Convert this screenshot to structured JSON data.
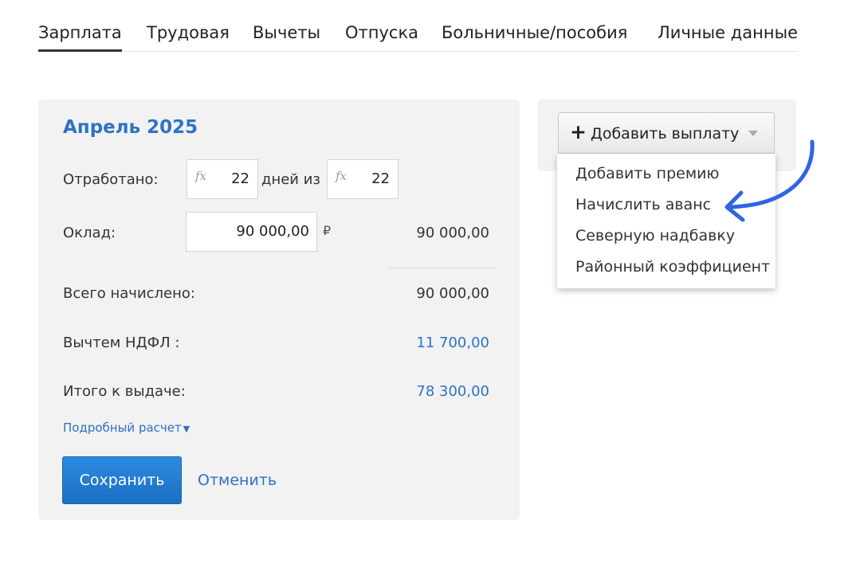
{
  "tabs": [
    {
      "label": "Зарплата",
      "active": true
    },
    {
      "label": "Трудовая"
    },
    {
      "label": "Вычеты"
    },
    {
      "label": "Отпуска"
    },
    {
      "label": "Больничные/пособия"
    },
    {
      "label": "Личные данные"
    }
  ],
  "card": {
    "title": "Апрель 2025",
    "worked": {
      "label": "Отработано:",
      "days": "22",
      "of_label": "дней из",
      "total": "22",
      "formula_icon": "fx-icon"
    },
    "salary": {
      "label": "Оклад:",
      "input_value": "90 000,00",
      "currency": "₽",
      "amount": "90 000,00"
    },
    "total_accrued": {
      "label": "Всего начислено:",
      "value": "90 000,00"
    },
    "tax": {
      "label": "Вычтем НДФЛ :",
      "value": "11 700,00"
    },
    "to_pay": {
      "label": "Итого к выдаче:",
      "value": "78 300,00"
    },
    "details_link": "Подробный расчет",
    "save_label": "Сохранить",
    "cancel_label": "Отменить"
  },
  "side": {
    "add_button": "Добавить выплату",
    "menu": [
      "Добавить премию",
      "Начислить аванс",
      "Северную надбавку",
      "Районный коэффициент"
    ]
  },
  "colors": {
    "accent": "#2e72c4",
    "button": "#1a6fc4",
    "arrow": "#2f64e6"
  }
}
